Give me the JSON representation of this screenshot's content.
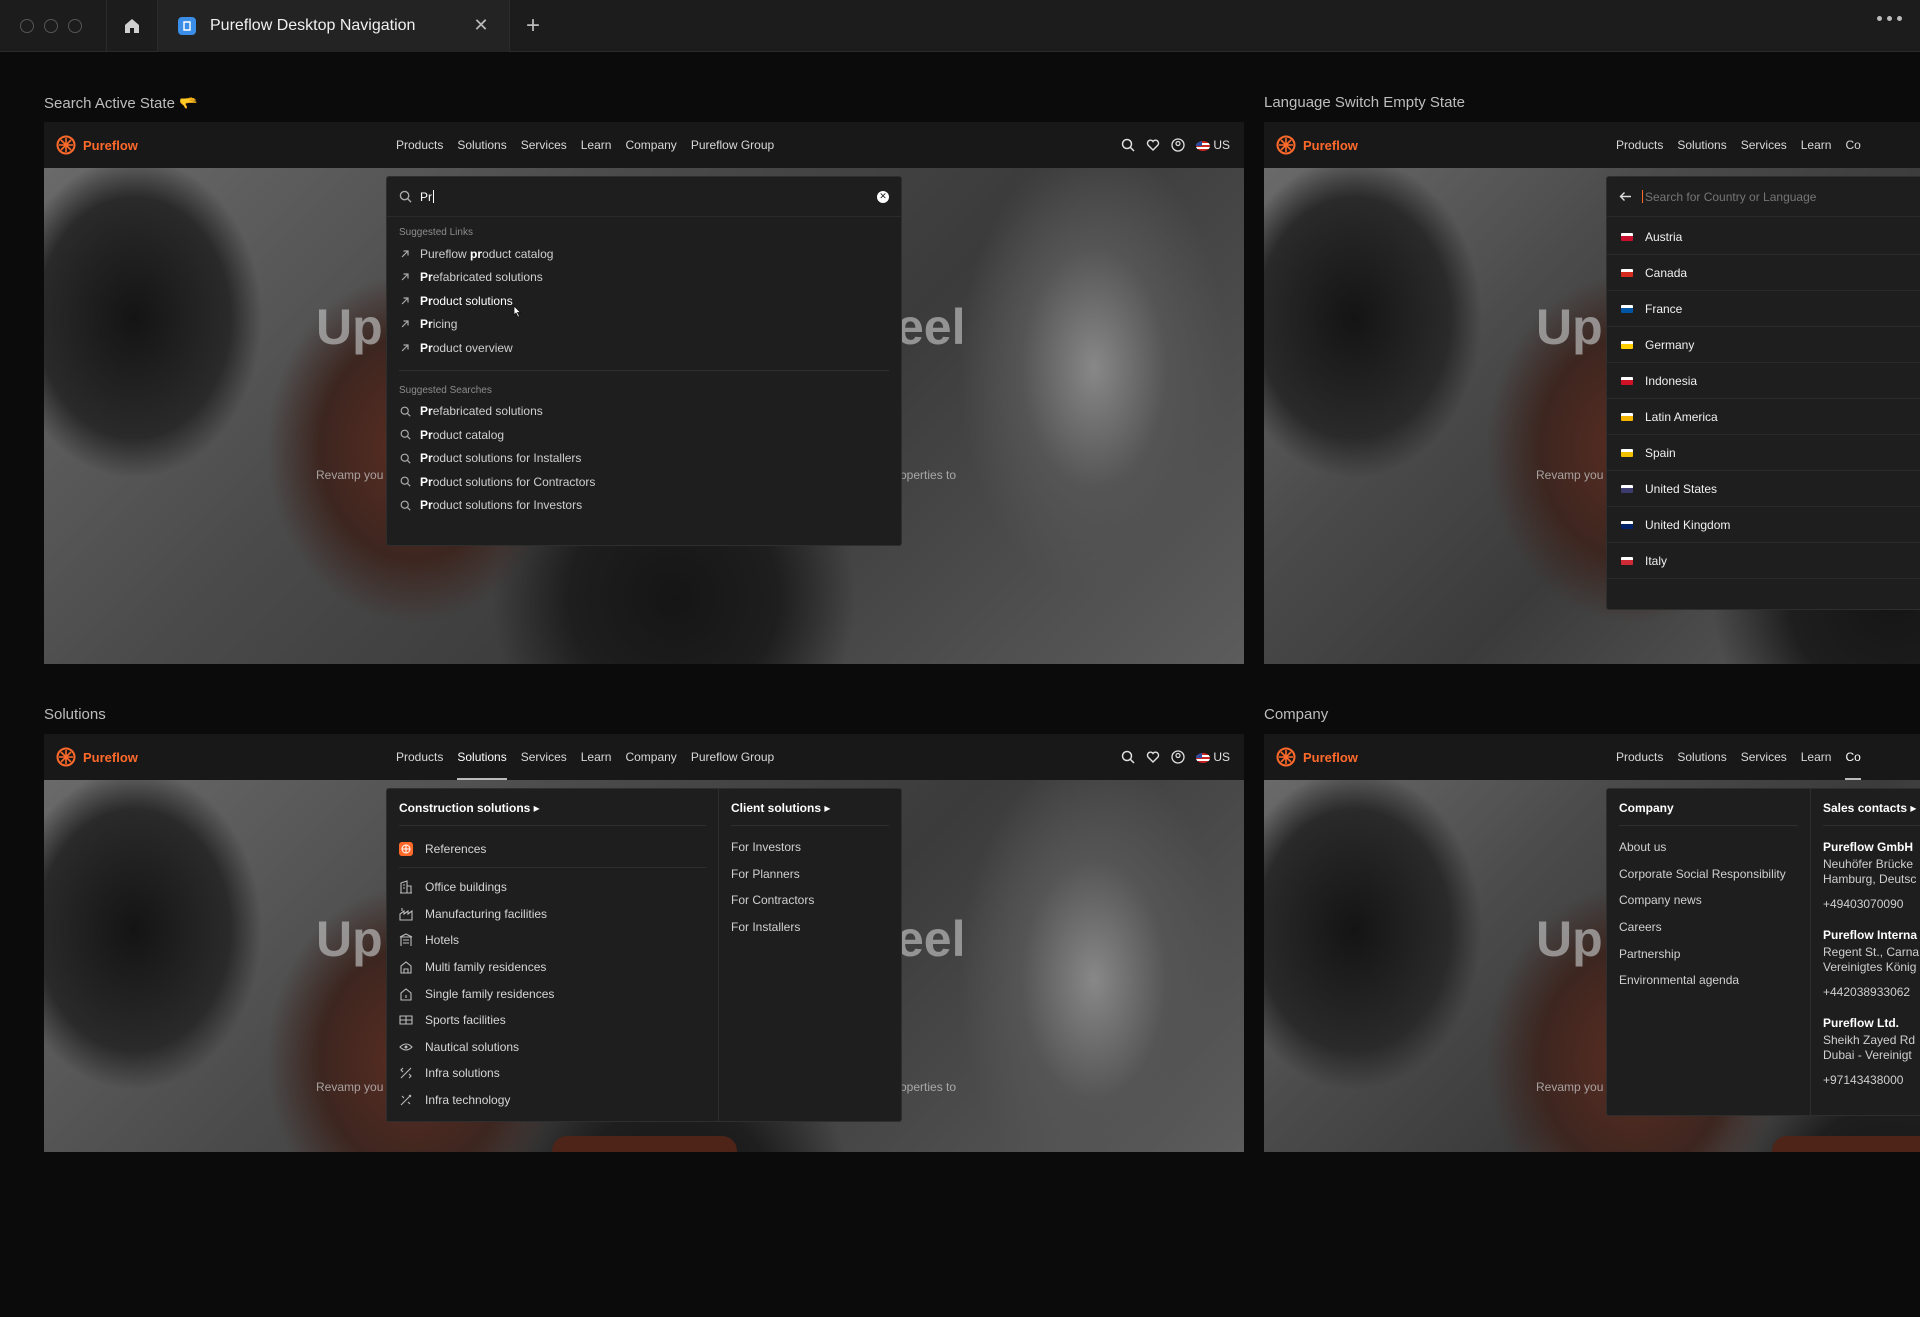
{
  "window": {
    "tab_title": "Pureflow Desktop Navigation"
  },
  "colors": {
    "brand": "#ff6a2b",
    "background": "#0b0b0b",
    "panel": "#1e1e1e"
  },
  "brand": {
    "name": "Pureflow"
  },
  "nav": {
    "links": [
      "Products",
      "Solutions",
      "Services",
      "Learn",
      "Company",
      "Pureflow Group"
    ],
    "right_links": [
      "Products",
      "Solutions",
      "Services",
      "Learn",
      "Co"
    ],
    "locale": "US",
    "icons": [
      "search-icon",
      "heart-icon",
      "account-icon",
      "flag-us-icon"
    ]
  },
  "hero": {
    "big_left": "Up",
    "big_right": "eel",
    "small_left": "Revamp you",
    "small_right": "operties to"
  },
  "frames": {
    "search": {
      "label": "Search Active State 🫳",
      "query": "Pr",
      "suggested_links_title": "Suggested Links",
      "suggested_links": [
        {
          "pre": "Pureflow ",
          "match": "pr",
          "post": "oduct catalog"
        },
        {
          "pre": "",
          "match": "Pr",
          "post": "efabricated solutions"
        },
        {
          "pre": "",
          "match": "Pr",
          "post": "oduct solutions"
        },
        {
          "pre": "",
          "match": "Pr",
          "post": "icing"
        },
        {
          "pre": "",
          "match": "Pr",
          "post": "oduct overview"
        }
      ],
      "suggested_searches_title": "Suggested Searches",
      "suggested_searches": [
        {
          "match": "Pr",
          "post": "efabricated solutions"
        },
        {
          "match": "Pr",
          "post": "oduct catalog"
        },
        {
          "match": "Pr",
          "post": "oduct solutions for Installers"
        },
        {
          "match": "Pr",
          "post": "oduct solutions for Contractors"
        },
        {
          "match": "Pr",
          "post": "oduct solutions for Investors"
        }
      ]
    },
    "language": {
      "label": "Language Switch Empty State",
      "placeholder": "Search for Country or Language",
      "countries": [
        {
          "name": "Austria",
          "flag": "#c8102e"
        },
        {
          "name": "Canada",
          "flag": "#d52b1e"
        },
        {
          "name": "France",
          "flag": "#0055a4"
        },
        {
          "name": "Germany",
          "flag": "#ffce00"
        },
        {
          "name": "Indonesia",
          "flag": "#ce1126"
        },
        {
          "name": "Latin America",
          "flag": "#f4b400"
        },
        {
          "name": "Spain",
          "flag": "#f1bf00"
        },
        {
          "name": "United States",
          "flag": "#3c3b6e"
        },
        {
          "name": "United Kingdom",
          "flag": "#012169"
        },
        {
          "name": "Italy",
          "flag": "#ce2b37"
        }
      ]
    },
    "solutions": {
      "label": "Solutions",
      "col1_title": "Construction solutions",
      "featured": "References",
      "items": [
        {
          "label": "Office buildings",
          "icon": "office-building-icon"
        },
        {
          "label": "Manufacturing facilities",
          "icon": "factory-icon"
        },
        {
          "label": "Hotels",
          "icon": "hotel-icon"
        },
        {
          "label": "Multi family residences",
          "icon": "multi-family-home-icon"
        },
        {
          "label": "Single family residences",
          "icon": "single-family-home-icon"
        },
        {
          "label": "Sports facilities",
          "icon": "sports-facility-icon"
        },
        {
          "label": "Nautical solutions",
          "icon": "nautical-icon"
        },
        {
          "label": "Infra solutions",
          "icon": "infra-icon"
        },
        {
          "label": "Infra technology",
          "icon": "infra-technology-icon"
        }
      ],
      "col2_title": "Client solutions",
      "client_items": [
        "For Investors",
        "For Planners",
        "For Contractors",
        "For Installers"
      ]
    },
    "company": {
      "label": "Company",
      "col1_title": "Company",
      "items": [
        "About us",
        "Corporate Social Responsibility",
        "Company news",
        "Careers",
        "Partnership",
        "Environmental agenda"
      ],
      "col2_title": "Sales contacts",
      "contacts": [
        {
          "name": "Pureflow GmbH",
          "line1": "Neuhöfer Brücke",
          "line2": "Hamburg, Deutsc",
          "phone": "+49403070090"
        },
        {
          "name": "Pureflow Interna",
          "line1": "Regent St., Carna",
          "line2": "Vereinigtes König",
          "phone": "+442038933062"
        },
        {
          "name": "Pureflow Ltd.",
          "line1": "Sheikh Zayed Rd",
          "line2": "Dubai - Vereinigt",
          "phone": "+97143438000"
        }
      ]
    }
  }
}
